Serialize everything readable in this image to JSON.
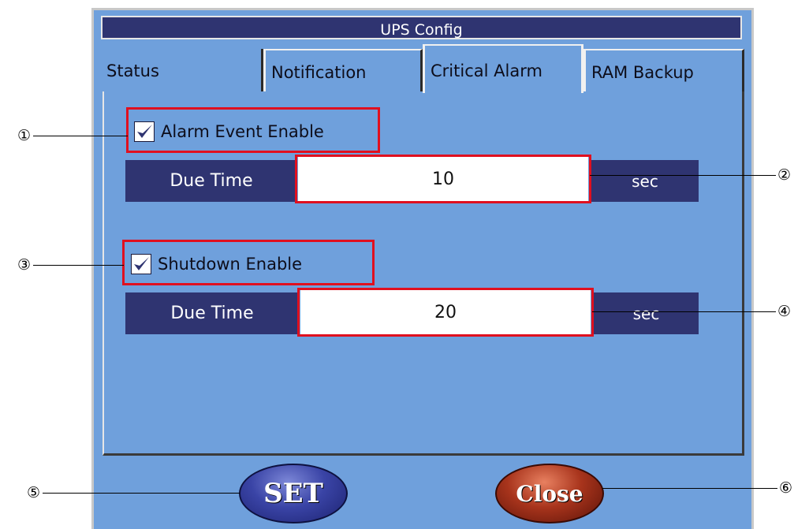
{
  "window": {
    "title": "UPS Config"
  },
  "tabs": [
    {
      "label": "Status"
    },
    {
      "label": "Notification"
    },
    {
      "label": "Critical Alarm"
    },
    {
      "label": "RAM Backup"
    }
  ],
  "alarm": {
    "checkbox_label": "Alarm Event Enable",
    "checked": true,
    "due_time_label": "Due Time",
    "due_time_value": "10",
    "unit": "sec"
  },
  "shutdown": {
    "checkbox_label": "Shutdown Enable",
    "checked": true,
    "due_time_label": "Due Time",
    "due_time_value": "20",
    "unit": "sec"
  },
  "buttons": {
    "set_label": "SET",
    "close_label": "Close"
  },
  "callouts": [
    "①",
    "②",
    "③",
    "④",
    "⑤",
    "⑥"
  ],
  "colors": {
    "panel": "#6fa0dc",
    "dark_block": "#2f3471",
    "highlight": "#e0101f"
  }
}
